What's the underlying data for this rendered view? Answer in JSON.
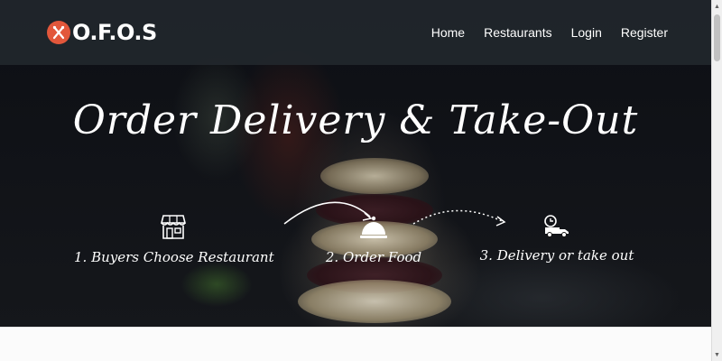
{
  "navbar": {
    "brand": "O.F.O.S",
    "links": [
      "Home",
      "Restaurants",
      "Login",
      "Register"
    ]
  },
  "hero": {
    "headline": "Order Delivery & Take-Out",
    "steps": [
      {
        "label": "1. Buyers Choose Restaurant",
        "icon": "storefront-icon"
      },
      {
        "label": "2. Order Food",
        "icon": "cloche-icon"
      },
      {
        "label": "3. Delivery or take out",
        "icon": "delivery-truck-icon"
      }
    ]
  },
  "colors": {
    "brand_accent": "#e2573b",
    "navbar_bg": "#22282e",
    "text": "#ffffff"
  }
}
